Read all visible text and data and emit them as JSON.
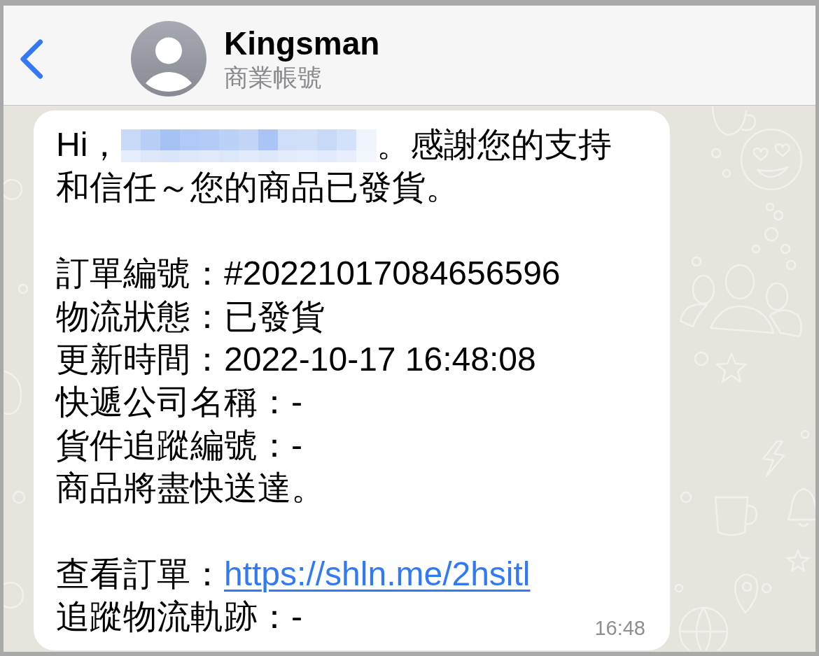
{
  "header": {
    "contact_name": "Kingsman",
    "subtitle": "商業帳號"
  },
  "message": {
    "greeting": {
      "lead": "Hi，",
      "tail": "。感謝您的支持",
      "continuation": "和信任～您的商品已發貨。"
    },
    "lines": [
      {
        "kind": "blank"
      },
      {
        "kind": "text",
        "text": "訂單編號：#20221017084656596"
      },
      {
        "kind": "text",
        "text": "物流狀態：已發貨"
      },
      {
        "kind": "text",
        "text": "更新時間：2022-10-17 16:48:08"
      },
      {
        "kind": "text",
        "text": "快遞公司名稱：-"
      },
      {
        "kind": "text",
        "text": "貨件追蹤編號：-"
      },
      {
        "kind": "text",
        "text": "商品將盡快送達。"
      },
      {
        "kind": "blank"
      },
      {
        "kind": "link",
        "label": "查看訂單：",
        "url": "https://shln.me/2hsitl"
      },
      {
        "kind": "text",
        "text": "追蹤物流軌跡：-"
      }
    ],
    "time": "16:48"
  }
}
